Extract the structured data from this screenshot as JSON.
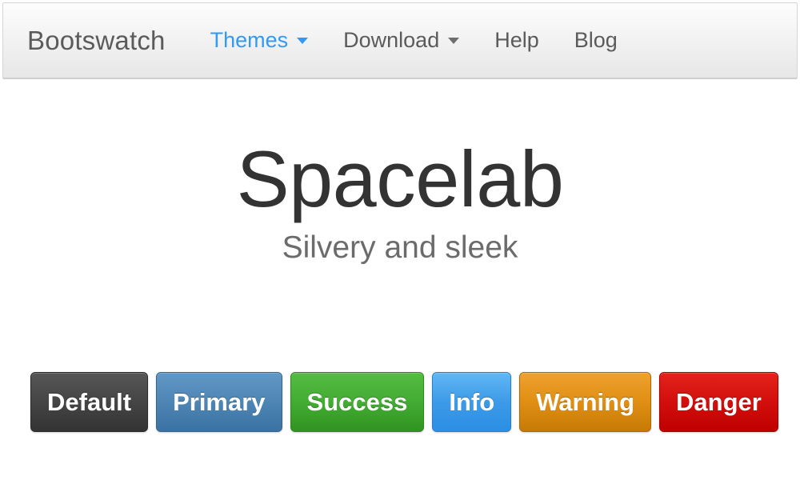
{
  "navbar": {
    "brand": "Bootswatch",
    "items": [
      {
        "label": "Themes",
        "has_caret": true,
        "active": true,
        "caret_color": "#3399f3"
      },
      {
        "label": "Download",
        "has_caret": true,
        "active": false,
        "caret_color": "#6e6e6e"
      },
      {
        "label": "Help",
        "has_caret": false,
        "active": false
      },
      {
        "label": "Blog",
        "has_caret": false,
        "active": false
      }
    ],
    "background_top": "#fdfdfd",
    "background_bottom": "#e7e7e7",
    "link_color": "#5b5b5b",
    "active_link_color": "#3399f3"
  },
  "hero": {
    "title": "Spacelab",
    "subtitle": "Silvery and sleek",
    "title_color": "#333333",
    "subtitle_color": "#6b6b6b"
  },
  "buttons": [
    {
      "label": "Default",
      "variant": "default",
      "color": "#454545"
    },
    {
      "label": "Primary",
      "variant": "primary",
      "color": "#4d85b5"
    },
    {
      "label": "Success",
      "variant": "success",
      "color": "#43ac33"
    },
    {
      "label": "Info",
      "variant": "info",
      "color": "#3d9ae8"
    },
    {
      "label": "Warning",
      "variant": "warning",
      "color": "#e08f13"
    },
    {
      "label": "Danger",
      "variant": "danger",
      "color": "#d20f0c"
    }
  ],
  "page": {
    "background": "#ffffff"
  }
}
